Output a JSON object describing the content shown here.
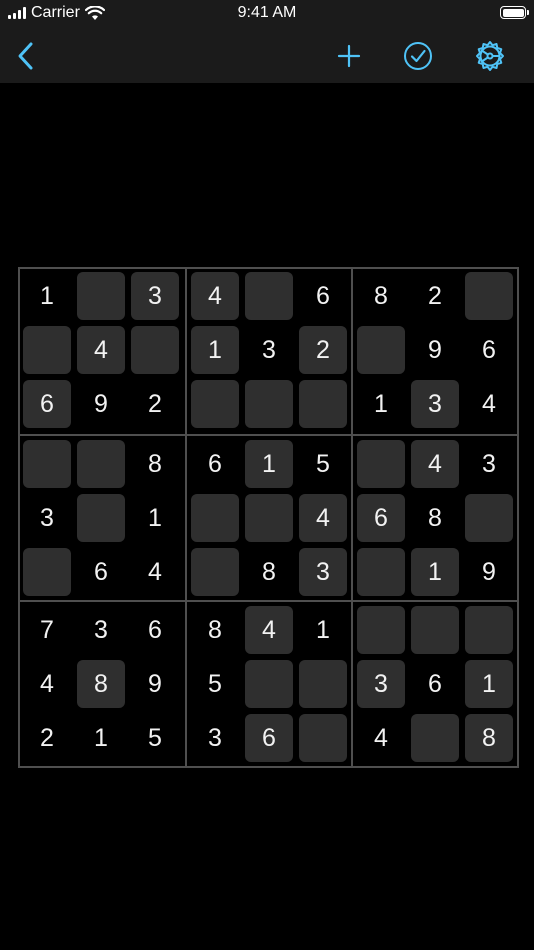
{
  "status_bar": {
    "carrier": "Carrier",
    "time": "9:41 AM"
  },
  "nav": {
    "back_icon": "chevron-left-icon",
    "new_game_icon": "plus-icon",
    "check_icon": "checkmark-circle-icon",
    "settings_icon": "gear-icon",
    "accent_color": "#4fc3f7"
  },
  "colors": {
    "background": "#000000",
    "bar_background": "#1b1b1b",
    "cell_tile": "#2f2f2f",
    "grid_line": "#4f4f4f",
    "digit": "#f2f2f2"
  },
  "board": {
    "rows": [
      [
        {
          "v": "1",
          "t": "given"
        },
        {
          "v": "",
          "t": "empty"
        },
        {
          "v": "3",
          "t": "user"
        },
        {
          "v": "4",
          "t": "user"
        },
        {
          "v": "",
          "t": "empty"
        },
        {
          "v": "6",
          "t": "given"
        },
        {
          "v": "8",
          "t": "given"
        },
        {
          "v": "2",
          "t": "given"
        },
        {
          "v": "",
          "t": "empty"
        }
      ],
      [
        {
          "v": "",
          "t": "empty"
        },
        {
          "v": "4",
          "t": "user"
        },
        {
          "v": "",
          "t": "empty"
        },
        {
          "v": "1",
          "t": "user"
        },
        {
          "v": "3",
          "t": "given"
        },
        {
          "v": "2",
          "t": "user"
        },
        {
          "v": "",
          "t": "empty"
        },
        {
          "v": "9",
          "t": "given"
        },
        {
          "v": "6",
          "t": "given"
        }
      ],
      [
        {
          "v": "6",
          "t": "user"
        },
        {
          "v": "9",
          "t": "given"
        },
        {
          "v": "2",
          "t": "given"
        },
        {
          "v": "",
          "t": "empty"
        },
        {
          "v": "",
          "t": "empty"
        },
        {
          "v": "",
          "t": "empty"
        },
        {
          "v": "1",
          "t": "given"
        },
        {
          "v": "3",
          "t": "user"
        },
        {
          "v": "4",
          "t": "given"
        }
      ],
      [
        {
          "v": "",
          "t": "empty"
        },
        {
          "v": "",
          "t": "empty"
        },
        {
          "v": "8",
          "t": "given"
        },
        {
          "v": "6",
          "t": "given"
        },
        {
          "v": "1",
          "t": "user"
        },
        {
          "v": "5",
          "t": "given"
        },
        {
          "v": "",
          "t": "empty"
        },
        {
          "v": "4",
          "t": "user"
        },
        {
          "v": "3",
          "t": "given"
        }
      ],
      [
        {
          "v": "3",
          "t": "given"
        },
        {
          "v": "",
          "t": "empty"
        },
        {
          "v": "1",
          "t": "given"
        },
        {
          "v": "",
          "t": "empty"
        },
        {
          "v": "",
          "t": "empty"
        },
        {
          "v": "4",
          "t": "user"
        },
        {
          "v": "6",
          "t": "user"
        },
        {
          "v": "8",
          "t": "given"
        },
        {
          "v": "",
          "t": "empty"
        }
      ],
      [
        {
          "v": "",
          "t": "empty"
        },
        {
          "v": "6",
          "t": "given"
        },
        {
          "v": "4",
          "t": "given"
        },
        {
          "v": "",
          "t": "empty"
        },
        {
          "v": "8",
          "t": "given"
        },
        {
          "v": "3",
          "t": "user"
        },
        {
          "v": "",
          "t": "empty"
        },
        {
          "v": "1",
          "t": "user"
        },
        {
          "v": "9",
          "t": "given"
        }
      ],
      [
        {
          "v": "7",
          "t": "given"
        },
        {
          "v": "3",
          "t": "given"
        },
        {
          "v": "6",
          "t": "given"
        },
        {
          "v": "8",
          "t": "given"
        },
        {
          "v": "4",
          "t": "user"
        },
        {
          "v": "1",
          "t": "given"
        },
        {
          "v": "",
          "t": "empty"
        },
        {
          "v": "",
          "t": "empty"
        },
        {
          "v": "",
          "t": "empty"
        }
      ],
      [
        {
          "v": "4",
          "t": "given"
        },
        {
          "v": "8",
          "t": "user"
        },
        {
          "v": "9",
          "t": "given"
        },
        {
          "v": "5",
          "t": "given"
        },
        {
          "v": "",
          "t": "empty"
        },
        {
          "v": "",
          "t": "empty"
        },
        {
          "v": "3",
          "t": "user"
        },
        {
          "v": "6",
          "t": "given"
        },
        {
          "v": "1",
          "t": "user"
        }
      ],
      [
        {
          "v": "2",
          "t": "given"
        },
        {
          "v": "1",
          "t": "given"
        },
        {
          "v": "5",
          "t": "given"
        },
        {
          "v": "3",
          "t": "given"
        },
        {
          "v": "6",
          "t": "user"
        },
        {
          "v": "",
          "t": "empty"
        },
        {
          "v": "4",
          "t": "given"
        },
        {
          "v": "",
          "t": "empty"
        },
        {
          "v": "8",
          "t": "user"
        }
      ]
    ]
  }
}
